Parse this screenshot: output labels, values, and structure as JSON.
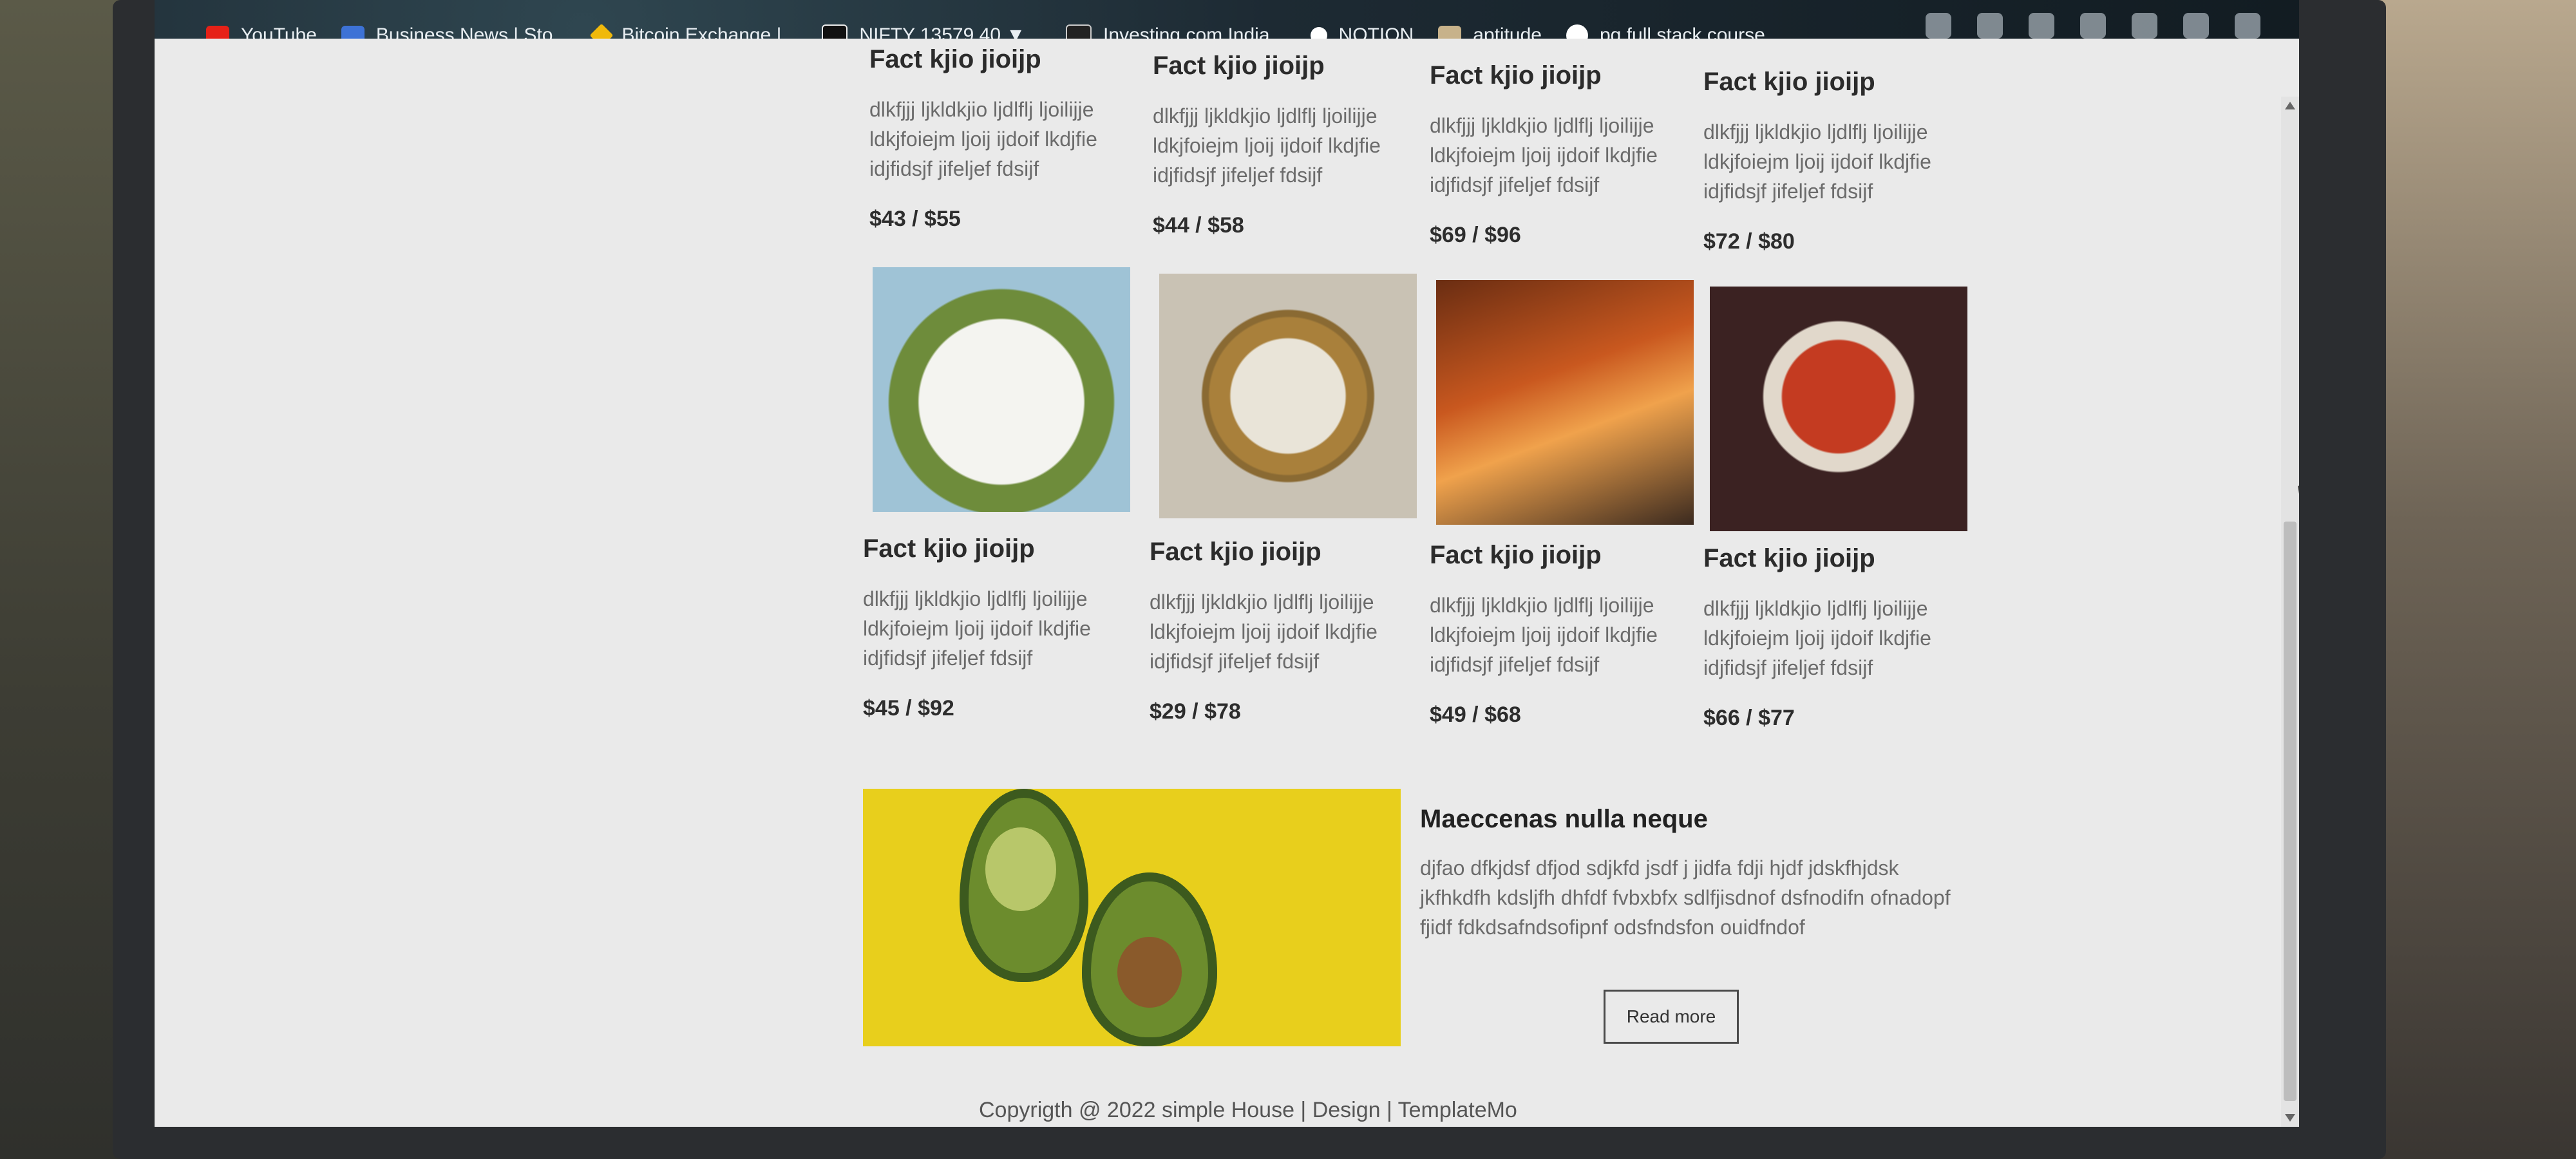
{
  "bookmarks": [
    {
      "label": "YouTube",
      "icon": "youtube-icon"
    },
    {
      "label": "Business News | Sto...",
      "icon": "business-news-icon"
    },
    {
      "label": "Bitcoin Exchange |...",
      "icon": "binance-icon"
    },
    {
      "label": "NIFTY 13579.40 ▼...",
      "icon": "tradingview-icon"
    },
    {
      "label": "Investing.com India...",
      "icon": "investing-icon"
    },
    {
      "label": "NOTION",
      "icon": "notion-icon"
    },
    {
      "label": "aptitude",
      "icon": "folder-icon"
    },
    {
      "label": "pg full stack course",
      "icon": "github-icon"
    }
  ],
  "cards_top": [
    {
      "title": "Fact kjio jioijp",
      "desc": "dlkfjjj ljkldkjio ljdlflj ljoilijje ldkjfoiejm ljoij ijdoif lkdjfie idjfidsjf jifeljef fdsijf",
      "price": "$43 / $55"
    },
    {
      "title": "Fact kjio jioijp",
      "desc": "dlkfjjj ljkldkjio ljdlflj ljoilijje ldkjfoiejm ljoij ijdoif lkdjfie idjfidsjf jifeljef fdsijf",
      "price": "$44 / $58"
    },
    {
      "title": "Fact kjio jioijp",
      "desc": "dlkfjjj ljkldkjio ljdlflj ljoilijje ldkjfoiejm ljoij ijdoif lkdjfie idjfidsjf jifeljef fdsijf",
      "price": "$69 / $96"
    },
    {
      "title": "Fact kjio jioijp",
      "desc": "dlkfjjj ljkldkjio ljdlflj ljoilijje ldkjfoiejm ljoij ijdoif lkdjfie idjfidsjf jifeljef fdsijf",
      "price": "$72 / $80"
    }
  ],
  "cards_bottom": [
    {
      "title": "Fact kjio jioijp",
      "desc": "dlkfjjj ljkldkjio ljdlflj ljoilijje ldkjfoiejm ljoij ijdoif lkdjfie idjfidsjf jifeljef fdsijf",
      "price": "$45 / $92"
    },
    {
      "title": "Fact kjio jioijp",
      "desc": "dlkfjjj ljkldkjio ljdlflj ljoilijje ldkjfoiejm ljoij ijdoif lkdjfie idjfidsjf jifeljef fdsijf",
      "price": "$29 / $78"
    },
    {
      "title": "Fact kjio jioijp",
      "desc": "dlkfjjj ljkldkjio ljdlflj ljoilijje ldkjfoiejm ljoij ijdoif lkdjfie idjfidsjf jifeljef fdsijf",
      "price": "$49 / $68"
    },
    {
      "title": "Fact kjio jioijp",
      "desc": "dlkfjjj ljkldkjio ljdlflj ljoilijje ldkjfoiejm ljoij ijdoif lkdjfie idjfidsjf jifeljef fdsijf",
      "price": "$66 / $77"
    }
  ],
  "feature": {
    "title": "Maeccenas nulla neque",
    "text": "djfao dfkjdsf dfjod sdjkfd jsdf j jidfa fdji hjdf jdskfhjdsk jkfhkdfh kdsljfh dhfdf fvbxbfx sdlfjisdnof dsfnodifn ofnadopf fjidf fdkdsafndsofipnf odsfndsfon ouidfndof",
    "button": "Read more"
  },
  "footer": "Copyrigth @ 2022 simple House | Design | TemplateMo"
}
